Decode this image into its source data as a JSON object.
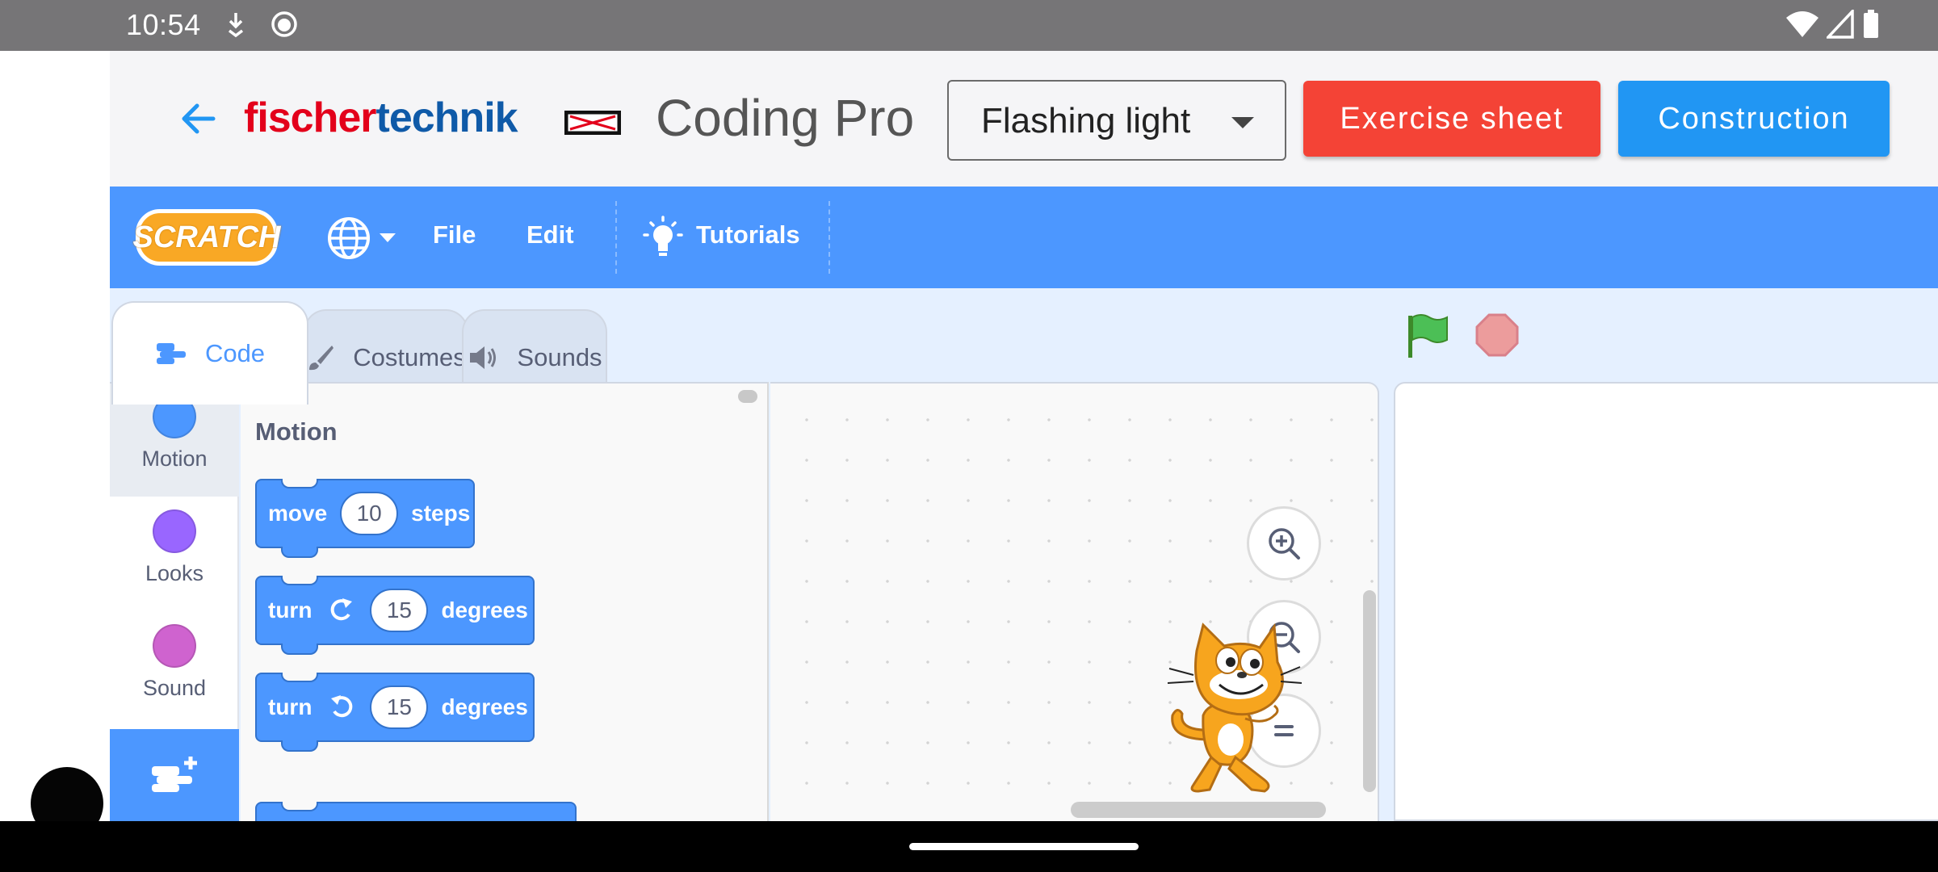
{
  "status_bar": {
    "time": "10:54",
    "icons": [
      "download-icon",
      "notification-icon",
      "wifi-icon",
      "signal-icon",
      "battery-icon"
    ]
  },
  "app_header": {
    "logo_part1": "fischer",
    "logo_part2": "technik",
    "title": "Coding Pro",
    "exercise_select_value": "Flashing light",
    "exercise_sheet_button": "Exercise sheet",
    "construction_button": "Construction",
    "colors": {
      "exercise_sheet": "#f44336",
      "construction": "#2196f3",
      "logo_red": "#e3001b",
      "logo_blue": "#0f5aa8"
    }
  },
  "scratch_menu": {
    "logo_text": "SCRATCH",
    "file": "File",
    "edit": "Edit",
    "tutorials": "Tutorials",
    "color": "#4c97ff"
  },
  "tabs": [
    {
      "label": "Code",
      "active": true
    },
    {
      "label": "Costumes",
      "active": false
    },
    {
      "label": "Sounds",
      "active": false
    }
  ],
  "categories": [
    {
      "label": "Motion",
      "color": "#4c97ff"
    },
    {
      "label": "Looks",
      "color": "#9966ff"
    },
    {
      "label": "Sound",
      "color": "#cf63cf"
    }
  ],
  "palette": {
    "section_title": "Motion",
    "blocks": [
      {
        "pre": "move",
        "value": "10",
        "post": "steps"
      },
      {
        "pre": "turn",
        "value": "15",
        "post": "degrees",
        "icon": "rotate-right-icon"
      },
      {
        "pre": "turn",
        "value": "15",
        "post": "degrees",
        "icon": "rotate-left-icon"
      }
    ]
  }
}
